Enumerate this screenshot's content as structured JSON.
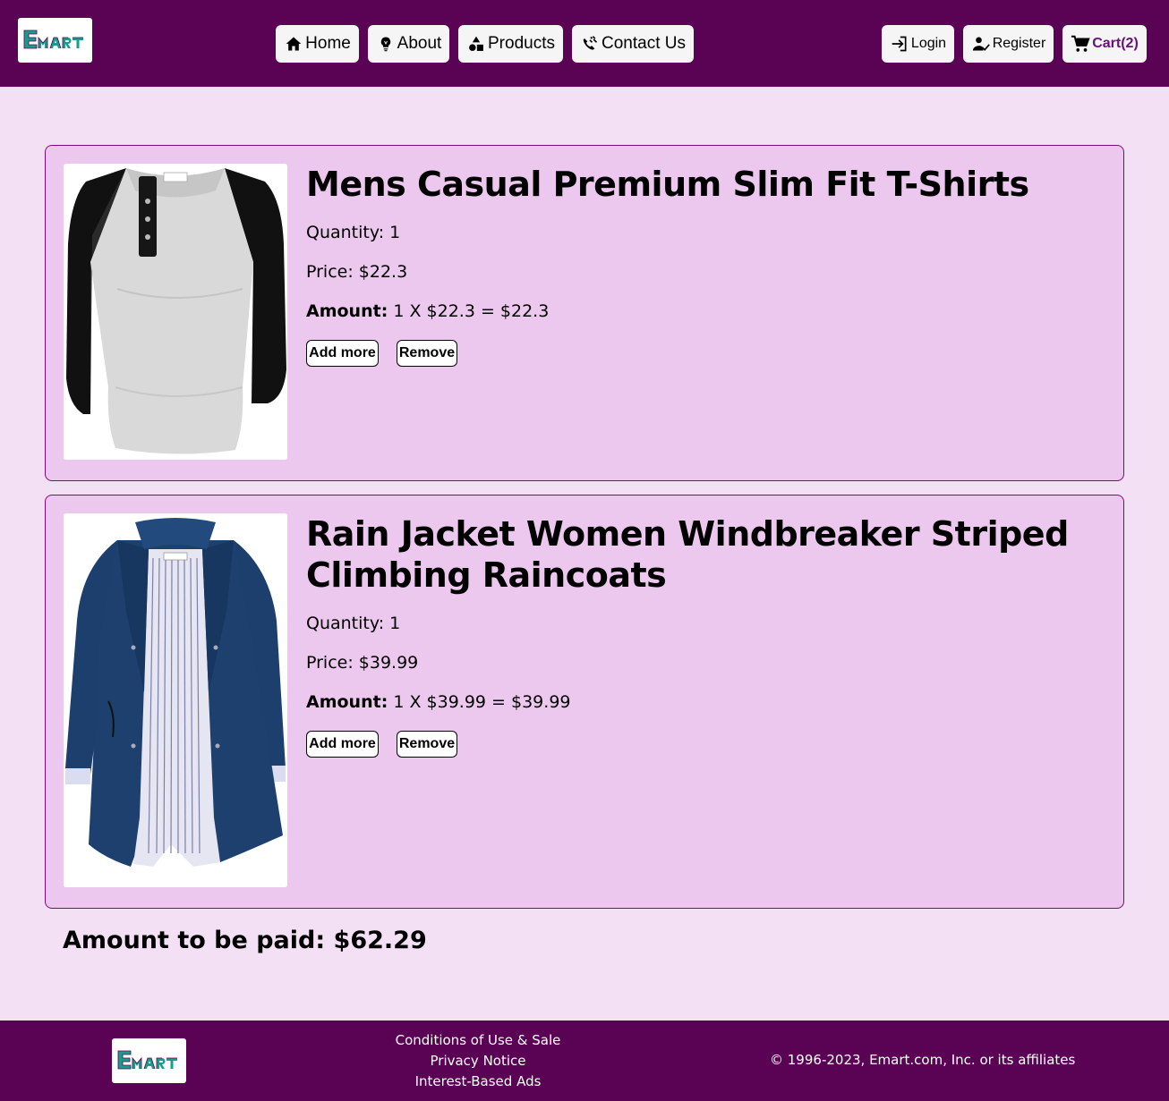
{
  "header": {
    "logo_text": "EMART",
    "nav": [
      {
        "label": "Home",
        "icon": "home-icon"
      },
      {
        "label": "About",
        "icon": "lightbulb-icon"
      },
      {
        "label": "Products",
        "icon": "shapes-icon"
      },
      {
        "label": "Contact Us",
        "icon": "contact-icon"
      }
    ],
    "auth": {
      "login": "Login",
      "register": "Register",
      "cart": "Cart(2)"
    }
  },
  "cart_items": [
    {
      "title": "Mens Casual Premium Slim Fit T-Shirts",
      "quantity": "Quantity: 1",
      "price": "Price: $22.3",
      "amount_label": "Amount:",
      "amount": "1 X $22.3 = $22.3",
      "add_label": "Add more",
      "remove_label": "Remove",
      "image": "raglan-henley-tshirt"
    },
    {
      "title": "Rain Jacket Women Windbreaker Striped Climbing Raincoats",
      "quantity": "Quantity: 1",
      "price": "Price: $39.99",
      "amount_label": "Amount:",
      "amount": "1 X $39.99 = $39.99",
      "add_label": "Add more",
      "remove_label": "Remove",
      "image": "navy-rain-jacket"
    }
  ],
  "total": "Amount to be paid: $62.29",
  "footer": {
    "links": [
      "Conditions of Use & Sale",
      "Privacy Notice",
      "Interest-Based Ads"
    ],
    "copyright": "© 1996-2023, Emart.com, Inc. or its affiliates"
  },
  "colors": {
    "brand": "#5a0253",
    "page_bg": "#f4e0f4",
    "card_bg": "#ecc8ee",
    "logo_teal": "#1a9c8c",
    "cart_accent": "#6a0f7b"
  }
}
